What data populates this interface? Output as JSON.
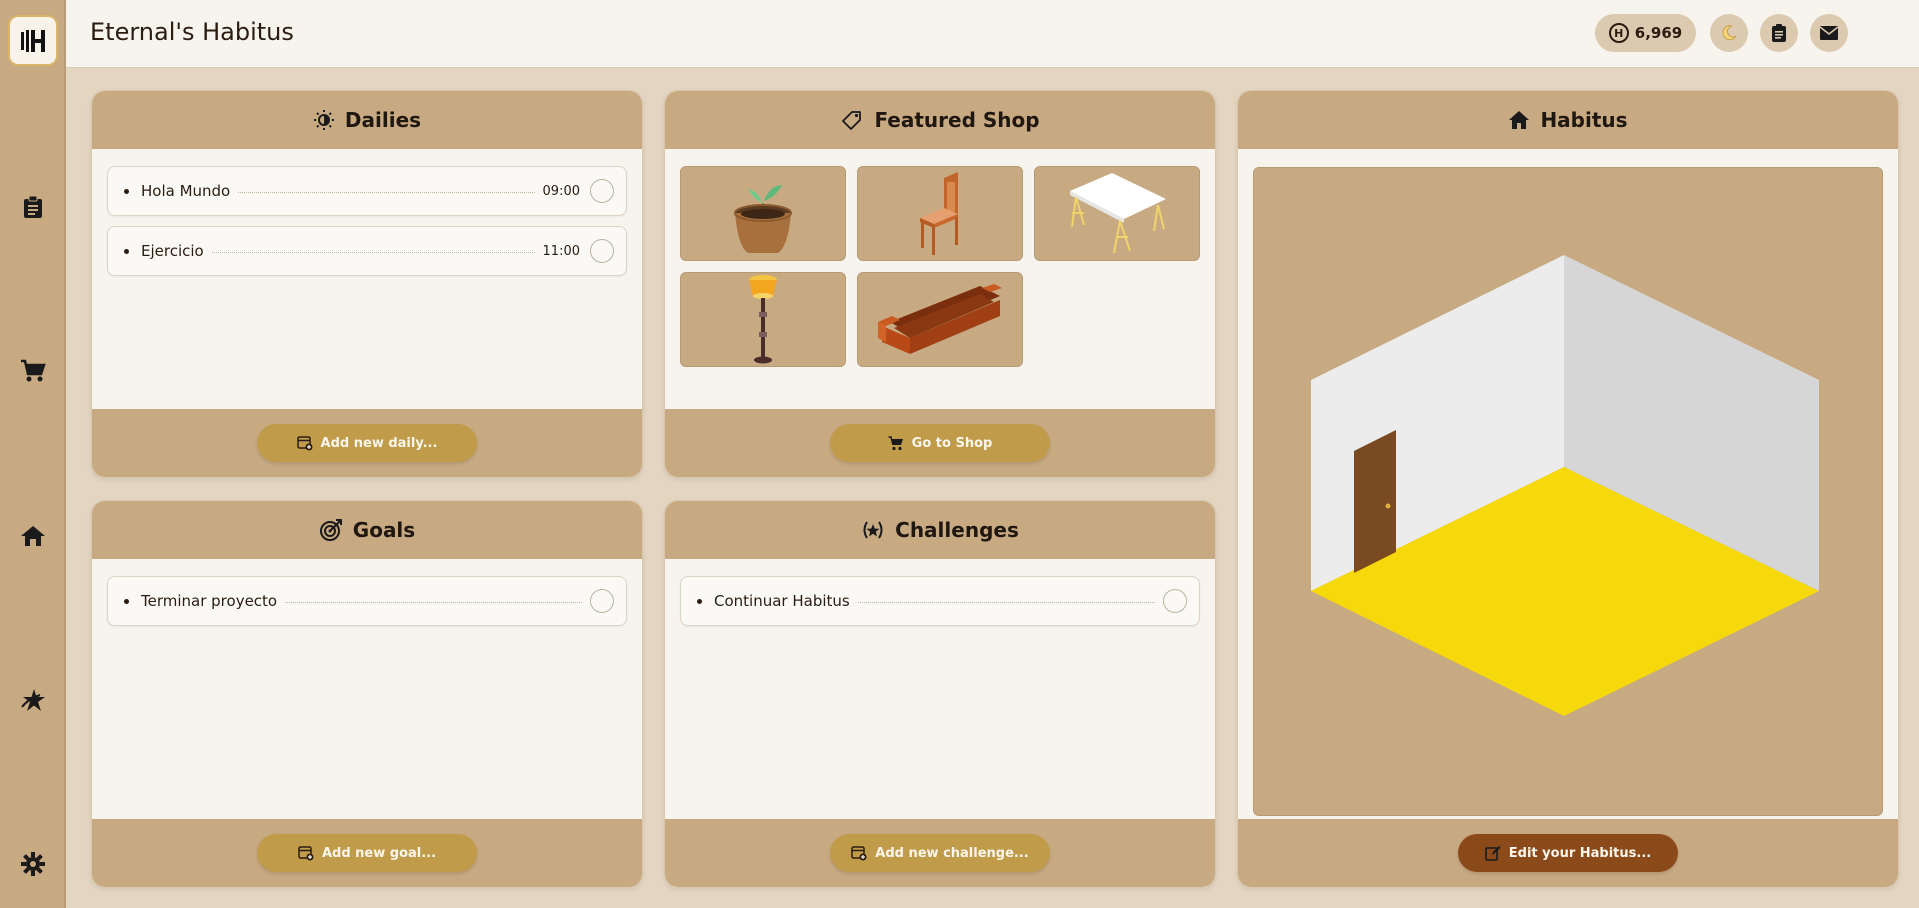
{
  "app": {
    "title": "Eternal's Habitus"
  },
  "topbar": {
    "coins": "6,969",
    "coin_symbol": "H"
  },
  "sidebar": {
    "items": [
      {
        "icon": "clipboard-icon"
      },
      {
        "icon": "cart-icon"
      },
      {
        "icon": "home-icon"
      },
      {
        "icon": "star-icon"
      },
      {
        "icon": "gear-icon"
      }
    ]
  },
  "dailies": {
    "title": "Dailies",
    "items": [
      {
        "label": "Hola Mundo",
        "time": "09:00"
      },
      {
        "label": "Ejercicio",
        "time": "11:00"
      }
    ],
    "button": "Add new daily..."
  },
  "shop": {
    "title": "Featured Shop",
    "items": [
      {
        "icon": "plant-pot-icon"
      },
      {
        "icon": "chair-icon"
      },
      {
        "icon": "table-icon"
      },
      {
        "icon": "floor-lamp-icon"
      },
      {
        "icon": "sofa-icon"
      }
    ],
    "button": "Go to Shop"
  },
  "habitus": {
    "title": "Habitus",
    "button": "Edit your Habitus..."
  },
  "goals": {
    "title": "Goals",
    "items": [
      {
        "label": "Terminar proyecto"
      }
    ],
    "button": "Add new goal..."
  },
  "challenges": {
    "title": "Challenges",
    "items": [
      {
        "label": "Continuar Habitus"
      }
    ],
    "button": "Add new challenge..."
  },
  "colors": {
    "sidebar": "#c8aa82",
    "page_bg": "#e3d5c0",
    "card_bg": "#f7f4ee",
    "button_gold": "#c09b4a",
    "button_brown": "#8b4a1a",
    "room_floor": "#f5d90a"
  }
}
